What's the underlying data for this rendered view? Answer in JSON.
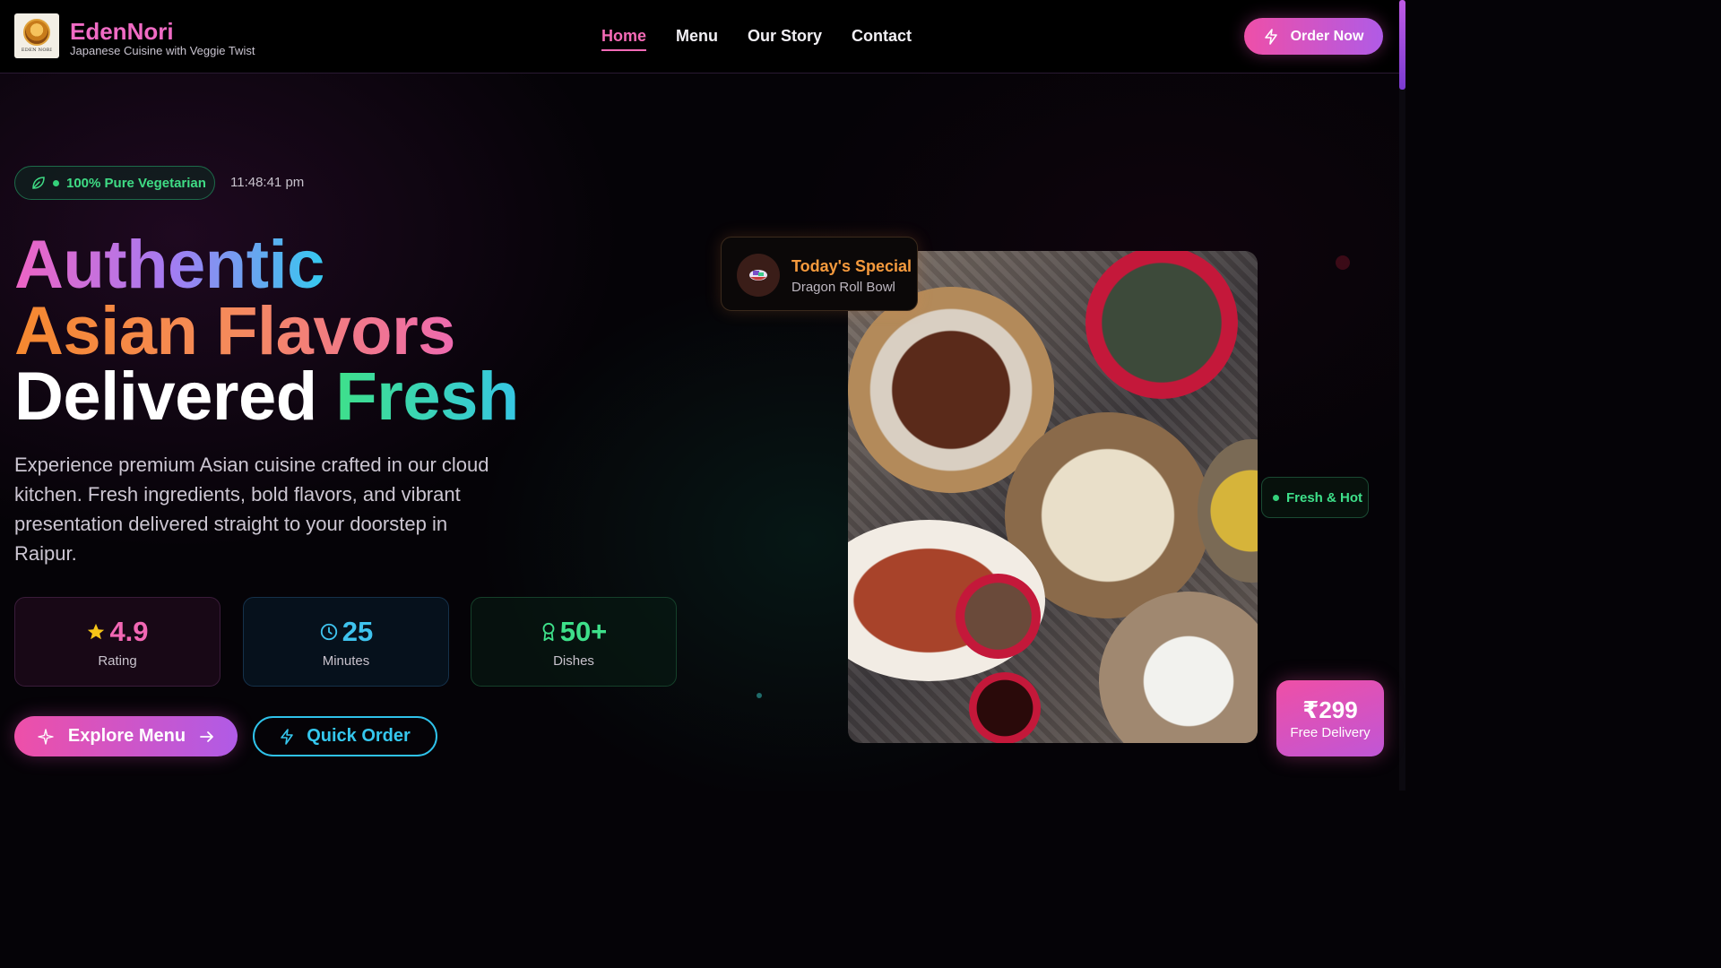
{
  "brand": {
    "name": "EdenNori",
    "tagline": "Japanese Cuisine with Veggie Twist",
    "logo_text": "EDEN NORI"
  },
  "nav": {
    "links": [
      "Home",
      "Menu",
      "Our Story",
      "Contact"
    ],
    "active": "Home",
    "cta": "Order Now"
  },
  "hero": {
    "badge": "100% Pure Vegetarian",
    "time": "11:48:41 pm",
    "headline_line1": "Authentic",
    "headline_line2": "Asian Flavors",
    "headline_line3_a": "Delivered",
    "headline_line3_b": "Fresh",
    "description": "Experience premium Asian cuisine crafted in our cloud kitchen. Fresh ingredients, bold flavors, and vibrant presentation delivered straight to your doorstep in Raipur.",
    "stats": [
      {
        "value": "4.9",
        "label": "Rating",
        "icon": "star-icon"
      },
      {
        "value": "25",
        "label": "Minutes",
        "icon": "clock-icon"
      },
      {
        "value": "50+",
        "label": "Dishes",
        "icon": "award-icon"
      }
    ],
    "primary_button": "Explore Menu",
    "secondary_button": "Quick Order"
  },
  "special": {
    "title": "Today's Special",
    "dish": "Dragon Roll Bowl"
  },
  "fresh_badge": "Fresh & Hot",
  "price": {
    "value": "₹299",
    "label": "Free Delivery"
  },
  "colors": {
    "accent_pink": "#ee4fa8",
    "accent_purple": "#b05be6",
    "accent_green": "#3ee08a",
    "accent_cyan": "#35c7ee",
    "accent_orange": "#f59a3d"
  }
}
